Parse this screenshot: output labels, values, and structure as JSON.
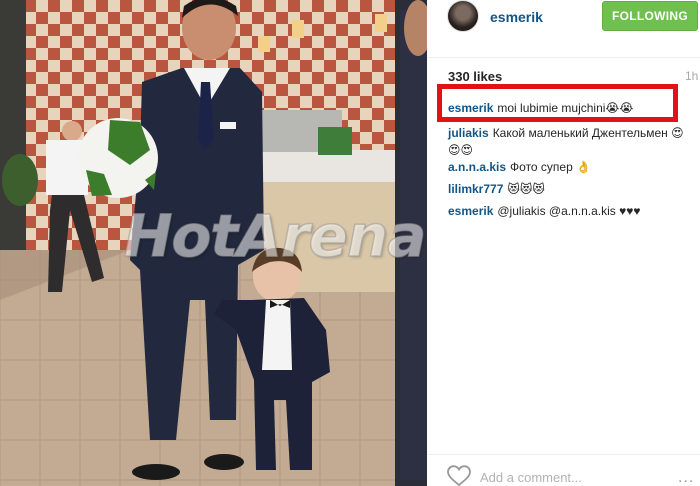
{
  "post": {
    "author": "esmerik",
    "follow_label": "FOLLOWING",
    "likes": "330 likes",
    "time_ago": "1h",
    "comments": [
      {
        "user": "esmerik",
        "text": "moi lubimie mujchini😭😭"
      },
      {
        "user": "juliakis",
        "text": "Какой маленький Джентельмен 😍😍😍"
      },
      {
        "user": "a.n.n.a.kis",
        "text": "Фото супер 👌"
      },
      {
        "user": "lilimkr777",
        "text": "😻😻😻"
      },
      {
        "user": "esmerik",
        "text": "@juliakis @a.n.n.a.kis ♥♥♥"
      }
    ],
    "comment_placeholder": "Add a comment...",
    "more_options": "..."
  },
  "watermark": "HotArena.net",
  "colors": {
    "username": "#125688",
    "follow_button": "#70c050",
    "highlight_box": "#e01216",
    "placeholder": "#b2b2b2"
  },
  "icons": {
    "like": "heart-outline-icon",
    "more": "more-options-icon"
  }
}
